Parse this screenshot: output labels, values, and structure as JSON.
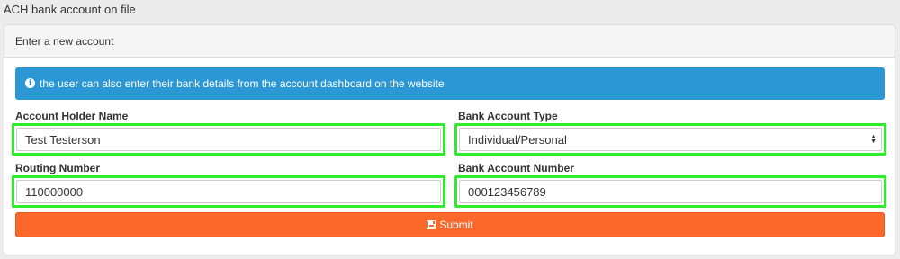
{
  "section": {
    "title": "ACH bank account on file"
  },
  "panel": {
    "heading": "Enter a new account"
  },
  "alert": {
    "icon": "info-circle-icon",
    "text": "the user can also enter their bank details from the account dashboard on the website"
  },
  "form": {
    "account_holder_name": {
      "label": "Account Holder Name",
      "value": "Test Testerson"
    },
    "bank_account_type": {
      "label": "Bank Account Type",
      "value": "Individual/Personal"
    },
    "routing_number": {
      "label": "Routing Number",
      "value": "110000000"
    },
    "bank_account_number": {
      "label": "Bank Account Number",
      "value": "000123456789"
    }
  },
  "submit": {
    "label": "Submit",
    "icon": "save-icon"
  },
  "colors": {
    "alert_bg": "#2b98d5",
    "submit_bg": "#fb682a",
    "highlight_border": "#2ded2d"
  }
}
